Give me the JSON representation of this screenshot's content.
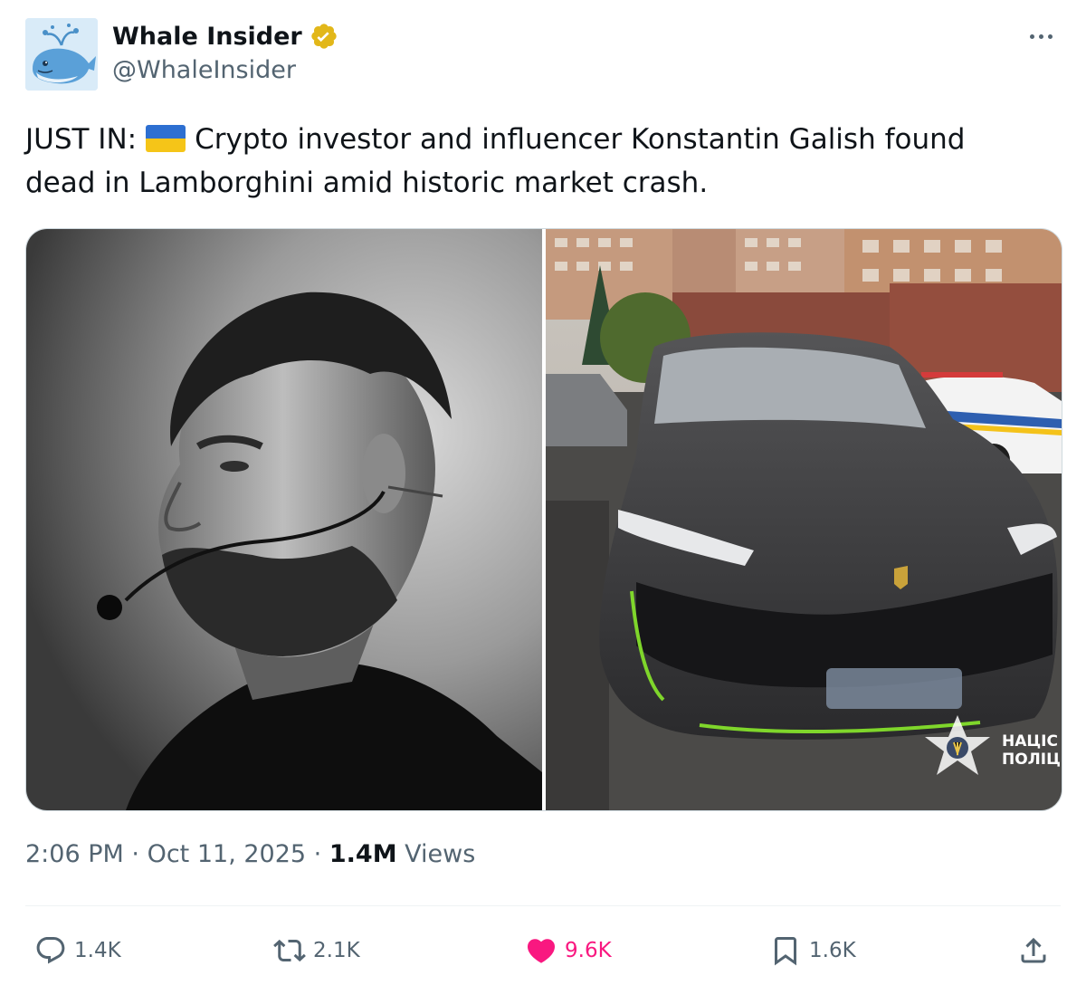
{
  "author": {
    "display_name": "Whale Insider",
    "handle": "@WhaleInsider",
    "verified": true,
    "avatar_icon": "whale-icon"
  },
  "tweet": {
    "text_prefix": "JUST IN:",
    "flag_icon": "ukraine-flag-icon",
    "text_body": "Crypto investor and influencer Konstantin Galish found dead in Lamborghini amid historic market crash."
  },
  "media": {
    "images": [
      {
        "name": "portrait-photo",
        "description_icon": "man-portrait-bw"
      },
      {
        "name": "lamborghini-photo",
        "description_icon": "black-lamborghini-urus"
      }
    ],
    "police_watermark_line1": "НАЦІС",
    "police_watermark_line2": "ПОЛІЦ"
  },
  "meta": {
    "time": "2:06 PM",
    "separator": "·",
    "date": "Oct 11, 2025",
    "views_count": "1.4M",
    "views_label": "Views"
  },
  "actions": {
    "reply_count": "1.4K",
    "retweet_count": "2.1K",
    "like_count": "9.6K",
    "bookmark_count": "1.6K"
  },
  "colors": {
    "text_primary": "#0f1419",
    "text_secondary": "#536471",
    "like_pink": "#f91880",
    "verified_gold": "#e2b719",
    "divider": "#eff3f4"
  }
}
